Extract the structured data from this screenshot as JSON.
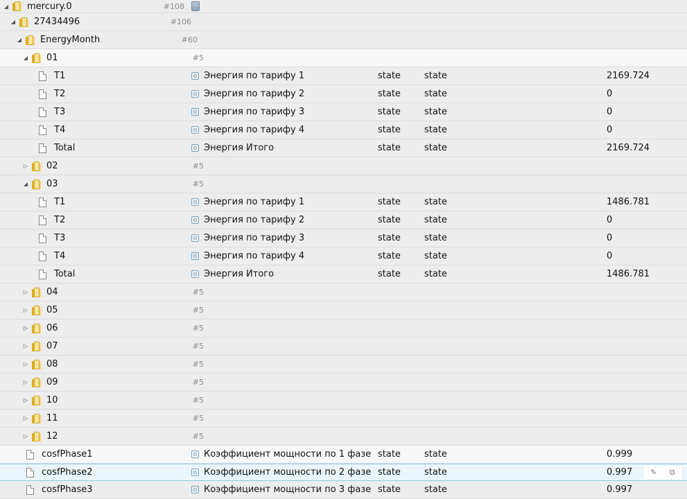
{
  "rows": [
    {
      "name": "mercury.0",
      "count": "#108",
      "desc": "",
      "type": "",
      "role": "",
      "value": ""
    },
    {
      "name": "27434496",
      "count": "#106",
      "desc": "",
      "type": "",
      "role": "",
      "value": ""
    },
    {
      "name": "EnergyMonth",
      "count": "#60",
      "desc": "",
      "type": "",
      "role": "",
      "value": ""
    },
    {
      "name": "01",
      "count": "#5",
      "desc": "",
      "type": "",
      "role": "",
      "value": ""
    },
    {
      "name": "T1",
      "count": "",
      "desc": "Энергия по тарифу 1",
      "type": "state",
      "role": "state",
      "value": "2169.724"
    },
    {
      "name": "T2",
      "count": "",
      "desc": "Энергия по тарифу 2",
      "type": "state",
      "role": "state",
      "value": "0"
    },
    {
      "name": "T3",
      "count": "",
      "desc": "Энергия по тарифу 3",
      "type": "state",
      "role": "state",
      "value": "0"
    },
    {
      "name": "T4",
      "count": "",
      "desc": "Энергия по тарифу 4",
      "type": "state",
      "role": "state",
      "value": "0"
    },
    {
      "name": "Total",
      "count": "",
      "desc": "Энергия Итого",
      "type": "state",
      "role": "state",
      "value": "2169.724"
    },
    {
      "name": "02",
      "count": "#5",
      "desc": "",
      "type": "",
      "role": "",
      "value": ""
    },
    {
      "name": "03",
      "count": "#5",
      "desc": "",
      "type": "",
      "role": "",
      "value": ""
    },
    {
      "name": "T1",
      "count": "",
      "desc": "Энергия по тарифу 1",
      "type": "state",
      "role": "state",
      "value": "1486.781"
    },
    {
      "name": "T2",
      "count": "",
      "desc": "Энергия по тарифу 2",
      "type": "state",
      "role": "state",
      "value": "0"
    },
    {
      "name": "T3",
      "count": "",
      "desc": "Энергия по тарифу 3",
      "type": "state",
      "role": "state",
      "value": "0"
    },
    {
      "name": "T4",
      "count": "",
      "desc": "Энергия по тарифу 4",
      "type": "state",
      "role": "state",
      "value": "0"
    },
    {
      "name": "Total",
      "count": "",
      "desc": "Энергия Итого",
      "type": "state",
      "role": "state",
      "value": "1486.781"
    },
    {
      "name": "04",
      "count": "#5",
      "desc": "",
      "type": "",
      "role": "",
      "value": ""
    },
    {
      "name": "05",
      "count": "#5",
      "desc": "",
      "type": "",
      "role": "",
      "value": ""
    },
    {
      "name": "06",
      "count": "#5",
      "desc": "",
      "type": "",
      "role": "",
      "value": ""
    },
    {
      "name": "07",
      "count": "#5",
      "desc": "",
      "type": "",
      "role": "",
      "value": ""
    },
    {
      "name": "08",
      "count": "#5",
      "desc": "",
      "type": "",
      "role": "",
      "value": ""
    },
    {
      "name": "09",
      "count": "#5",
      "desc": "",
      "type": "",
      "role": "",
      "value": ""
    },
    {
      "name": "10",
      "count": "#5",
      "desc": "",
      "type": "",
      "role": "",
      "value": ""
    },
    {
      "name": "11",
      "count": "#5",
      "desc": "",
      "type": "",
      "role": "",
      "value": ""
    },
    {
      "name": "12",
      "count": "#5",
      "desc": "",
      "type": "",
      "role": "",
      "value": ""
    },
    {
      "name": "cosfPhase1",
      "count": "",
      "desc": "Коэффициент мощности по 1 фазе",
      "type": "state",
      "role": "state",
      "value": "0.999"
    },
    {
      "name": "cosfPhase2",
      "count": "",
      "desc": "Коэффициент мощности по 2 фазе",
      "type": "state",
      "role": "state",
      "value": "0.997"
    },
    {
      "name": "cosfPhase3",
      "count": "",
      "desc": "Коэффициент мощности по 3 фазе",
      "type": "state",
      "role": "state",
      "value": "0.997"
    }
  ],
  "icons": {
    "row_edit": "pencil-icon",
    "row_copy": "copy-icon"
  }
}
